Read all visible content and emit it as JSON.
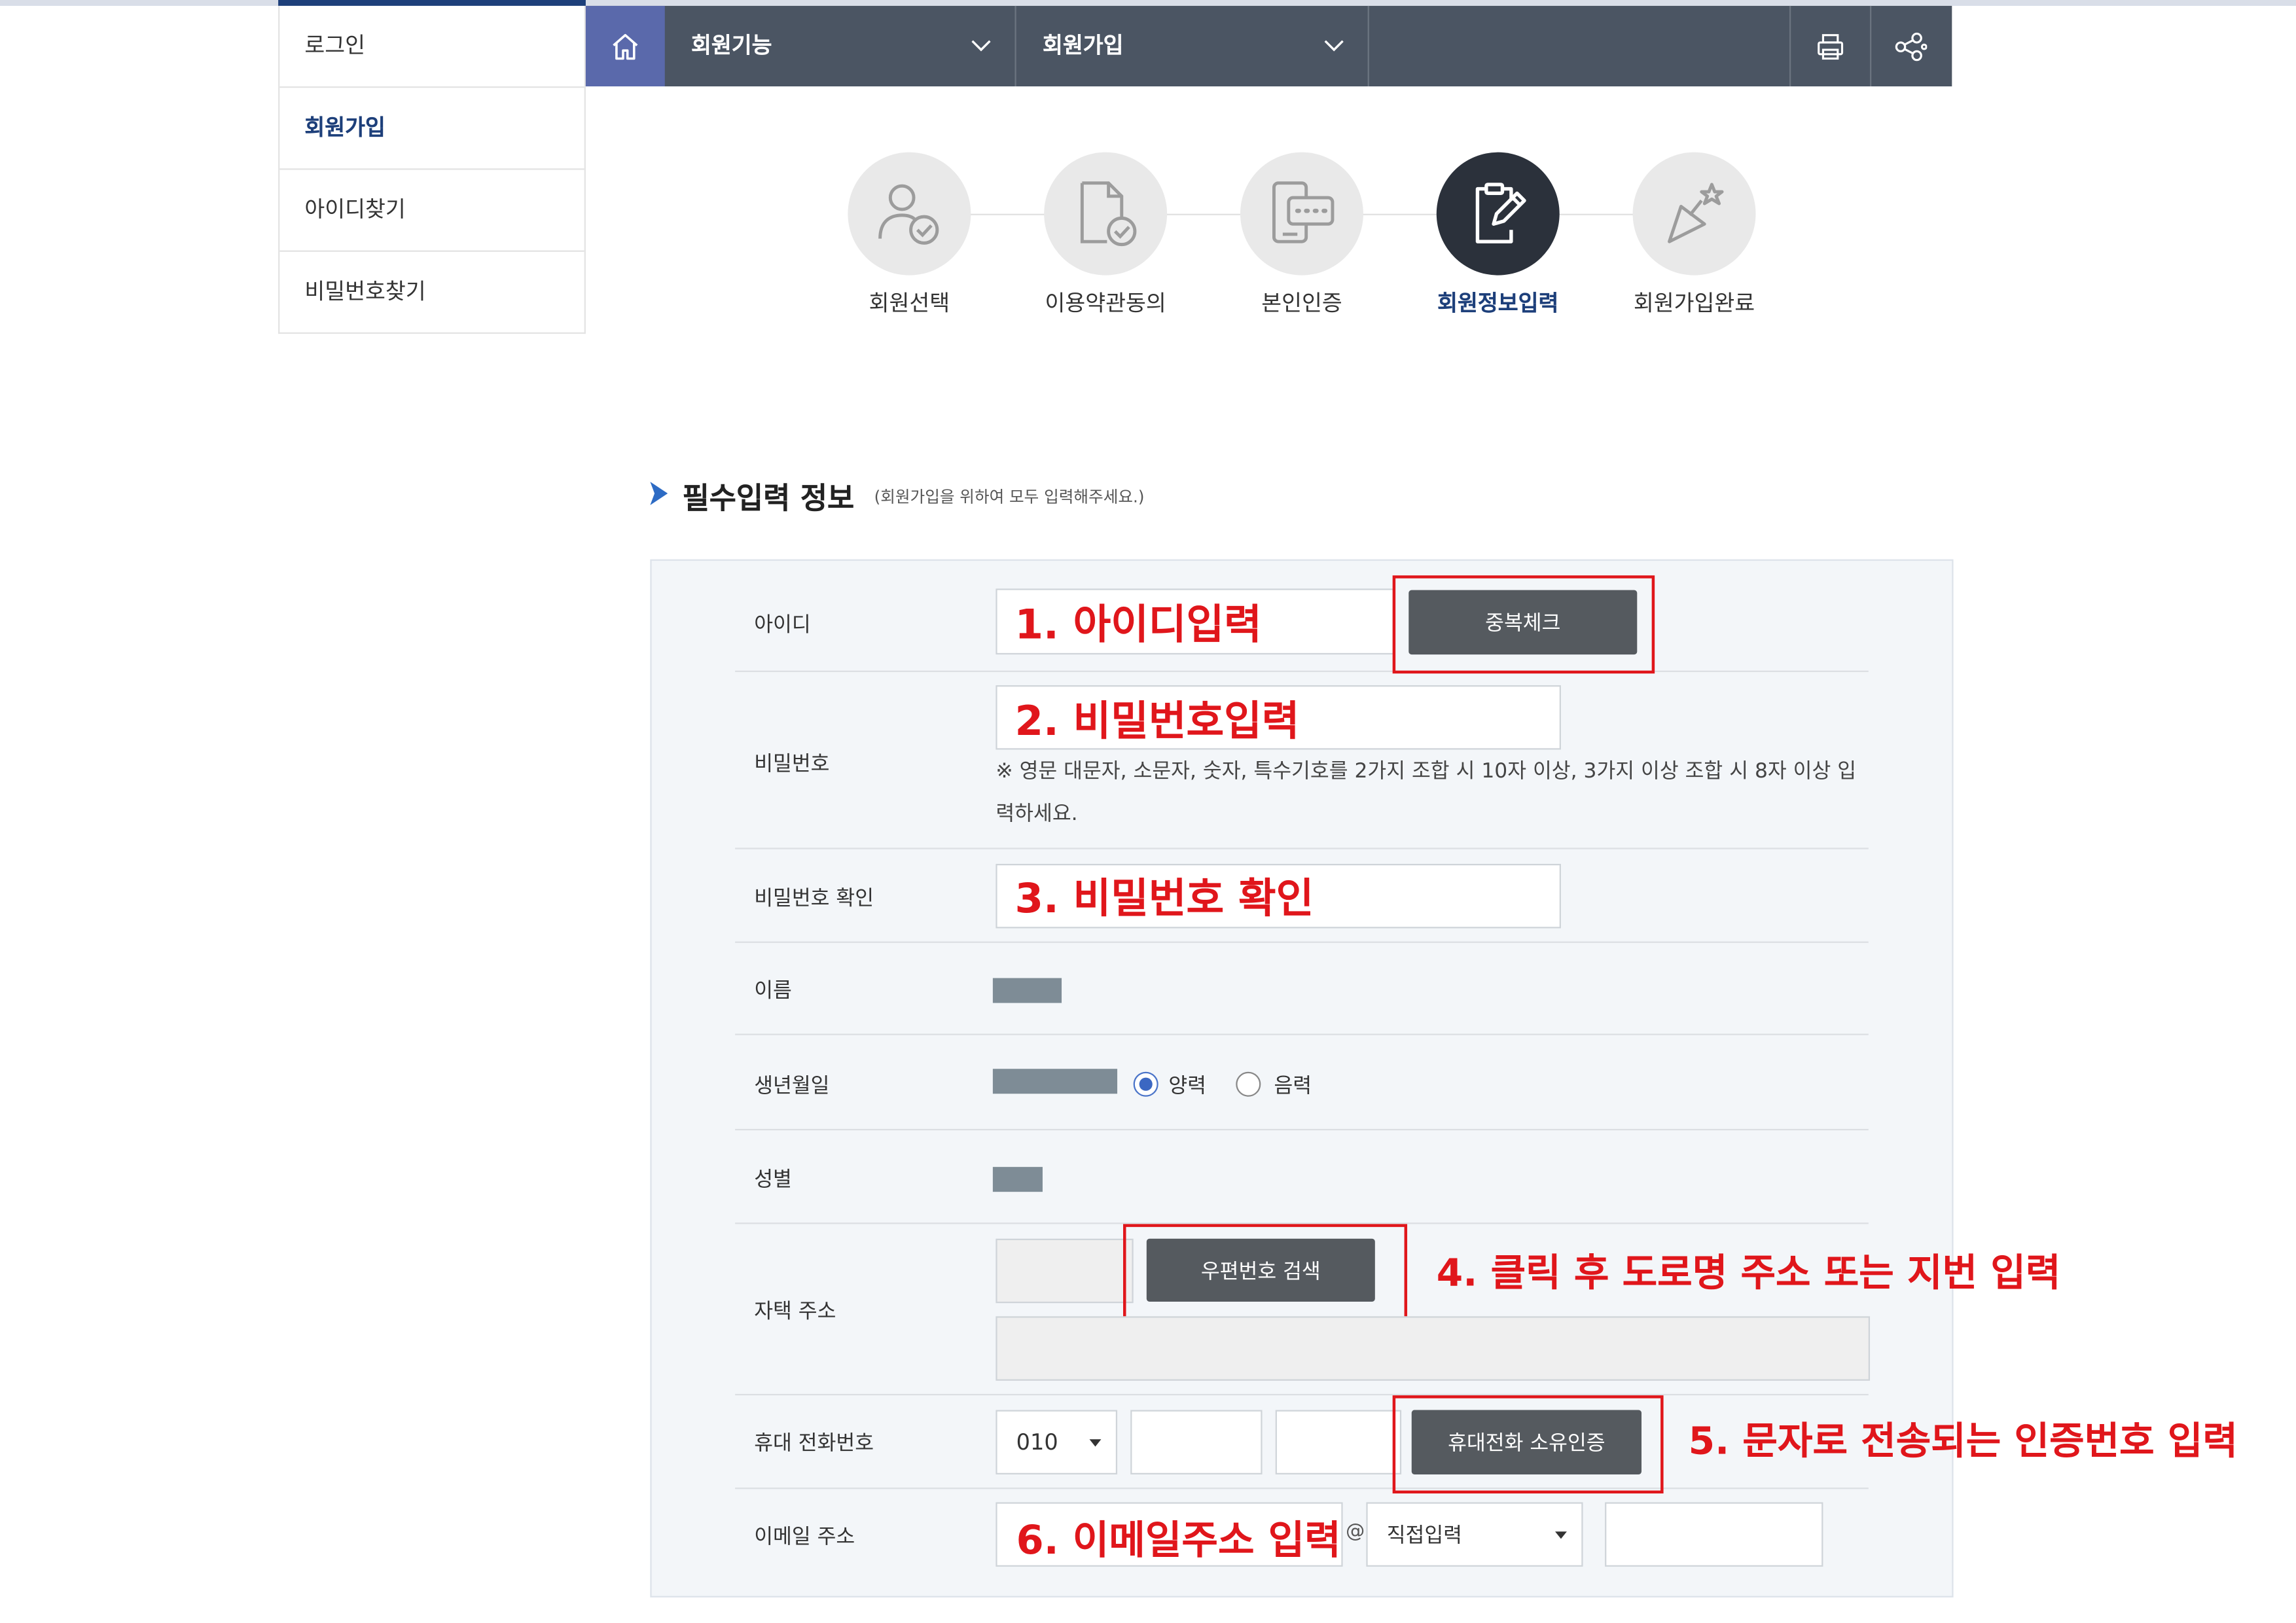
{
  "sidebar": {
    "items": [
      {
        "label": "로그인"
      },
      {
        "label": "회원가입"
      },
      {
        "label": "아이디찾기"
      },
      {
        "label": "비밀번호찾기"
      }
    ]
  },
  "nav": {
    "menu1": "회원기능",
    "menu2": "회원가입",
    "icons": [
      "home-icon",
      "print-icon",
      "share-icon"
    ]
  },
  "steps": [
    {
      "label": "회원선택",
      "icon": "user-check-icon"
    },
    {
      "label": "이용약관동의",
      "icon": "document-check-icon"
    },
    {
      "label": "본인인증",
      "icon": "phone-auth-icon"
    },
    {
      "label": "회원정보입력",
      "icon": "clipboard-edit-icon",
      "active": true
    },
    {
      "label": "회원가입완료",
      "icon": "party-popper-icon"
    }
  ],
  "section": {
    "title": "필수입력 정보",
    "subtitle": "(회원가입을 위하여 모두 입력해주세요.)"
  },
  "form": {
    "id_label": "아이디",
    "dup_check": "중복체크",
    "pw_label": "비밀번호",
    "pw_hint": "※ 영문 대문자, 소문자, 숫자, 특수기호를 2가지 조합 시 10자 이상, 3가지 이상 조합 시 8자 이상 입력하세요.",
    "pw_confirm_label": "비밀번호 확인",
    "name_label": "이름",
    "birth_label": "생년월일",
    "solar": "양력",
    "lunar": "음력",
    "gender_label": "성별",
    "address_label": "자택 주소",
    "zip_search": "우편번호 검색",
    "phone_label": "휴대 전화번호",
    "phone_prefix": "010",
    "phone_auth": "휴대전화 소유인증",
    "email_label": "이메일 주소",
    "email_at": "@",
    "email_domain": "직접입력"
  },
  "annotations": {
    "a1": "1. 아이디입력",
    "a2": "2. 비밀번호입력",
    "a3": "3. 비밀번호 확인",
    "a4": "4. 클릭 후 도로명 주소 또는 지번 입력",
    "a5": "5. 문자로 전송되는 인증번호 입력",
    "a6": "6. 이메일주소 입력"
  },
  "colors": {
    "nav_bg": "#4b5563",
    "home_bg": "#5a69ab",
    "brand_navy": "#1d3f7a",
    "annotation_red": "#e0161b",
    "button_dark": "#555a5f"
  }
}
